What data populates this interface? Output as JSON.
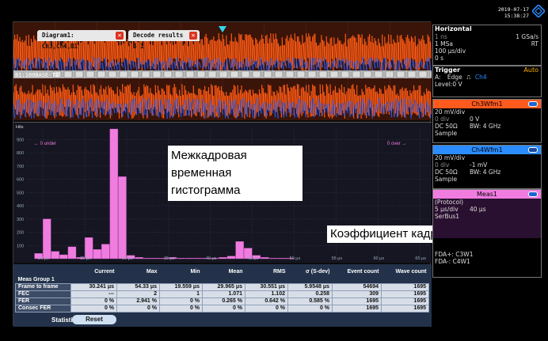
{
  "clock": {
    "date": "2019-07-17",
    "time": "15:38:27"
  },
  "tabs": [
    {
      "label": "Diagram1: Ch3,Ch4,B1",
      "close": "✕"
    },
    {
      "label": "Decode results B 1",
      "close": "✕"
    }
  ],
  "wave": {
    "bus_label": "B1:100BASE-T1"
  },
  "histogram": {
    "under_label": "← 0 under",
    "over_label": "0 over →",
    "y_ticks": [
      "900",
      "800",
      "700",
      "600",
      "500",
      "400",
      "300",
      "200",
      "100"
    ],
    "x_ticks": [
      "20 μs",
      "25 μs",
      "30 μs",
      "35 μs",
      "40 μs",
      "45 μs",
      "50 μs",
      "55 μs",
      "60 μs",
      "65 μs"
    ],
    "header": "Hits"
  },
  "callouts": {
    "histogram": "Межкадровая временная гистограмма",
    "fer": "Коэффициент кадровых ошибок"
  },
  "meas": {
    "columns": [
      "",
      "Current",
      "Max",
      "Min",
      "Mean",
      "RMS",
      "σ (S-dev)",
      "Event count",
      "Wave count"
    ],
    "group_label": "Meas Group 1",
    "rows": [
      [
        "Frame to frame",
        "30.241 μs",
        "54.33 μs",
        "19.559 μs",
        "29.965 μs",
        "30.551 μs",
        "5.9548 μs",
        "54694",
        "1695"
      ],
      [
        "FEC",
        "---",
        "2",
        "1",
        "1.071",
        "1.102",
        "0.258",
        "309",
        "1695"
      ],
      [
        "FER",
        "0 %",
        "2.941 %",
        "0 %",
        "0.265 %",
        "0.642 %",
        "0.585 %",
        "1695",
        "1695"
      ],
      [
        "Consec FER",
        "0 %",
        "0 %",
        "0 %",
        "0 %",
        "0 %",
        "0 %",
        "1695",
        "1695"
      ]
    ],
    "statistics_label": "Statistics:",
    "reset_label": "Reset"
  },
  "side": {
    "horizontal": {
      "title": "Horizontal",
      "l1_left": "1 ns",
      "l1_right": "1 GSa/s",
      "l2_left": "1 MSa",
      "l2_right": "RT",
      "l3": "100 μs/div",
      "l4": "0 s"
    },
    "trigger": {
      "title": "Trigger",
      "mode": "Auto",
      "source": "A:",
      "type": "Edge",
      "channel": "Ch4",
      "level": "Level:0 V"
    },
    "ch3": {
      "title": "Ch3Wfm1",
      "color": "#ff5a1e",
      "scale": "20 mV/div",
      "offset_label": "0 div",
      "offset_val": "0 V",
      "coupling": "DC 50Ω",
      "bw": "BW: 4 GHz",
      "acq": "Sample"
    },
    "ch4": {
      "title": "Ch4Wfm1",
      "color": "#2a8cff",
      "scale": "20 mV/div",
      "offset_label": "0 div",
      "offset_val": "-1 mV",
      "coupling": "DC 50Ω",
      "bw": "BW: 4 GHz",
      "acq": "Sample"
    },
    "meas1": {
      "title": "Meas1",
      "color": "#f07ce0",
      "l1": "(Protocol)",
      "l2_left": "5 μs/div",
      "l2_right": "40 μs",
      "l3": "SerBus1",
      "l4": "FDA+: C3W1",
      "l5": "FDA-: C4W1"
    }
  },
  "colors": {
    "wave_orange": "#ff5a14",
    "wave_blue": "#1e5cff",
    "hist_bar": "#f07ce0",
    "trigger": "#33d6f0"
  },
  "chart_data": {
    "type": "bar",
    "ylabel": "Hits",
    "ylim": [
      0,
      980
    ],
    "xlim": [
      18,
      66
    ],
    "x_unit": "μs",
    "series": [
      {
        "bins_x": [
          19.5,
          20.5,
          21.5,
          22.5,
          23.5,
          24.5,
          25.5,
          26.5,
          27.5,
          28.5,
          29.5,
          30.5,
          31.5,
          32.5,
          33.5,
          34.5,
          35.5,
          36.5,
          37.5,
          38.5,
          39.5,
          40.5,
          41.5,
          42.5,
          43.5,
          44.5,
          45.5,
          46.5,
          47.5,
          48.5,
          49.5
        ],
        "values": [
          40,
          300,
          55,
          30,
          90,
          10,
          160,
          70,
          110,
          980,
          620,
          25,
          10,
          5,
          5,
          5,
          10,
          5,
          5,
          5,
          5,
          5,
          10,
          20,
          130,
          80,
          25,
          10,
          5,
          5,
          5
        ]
      }
    ]
  }
}
